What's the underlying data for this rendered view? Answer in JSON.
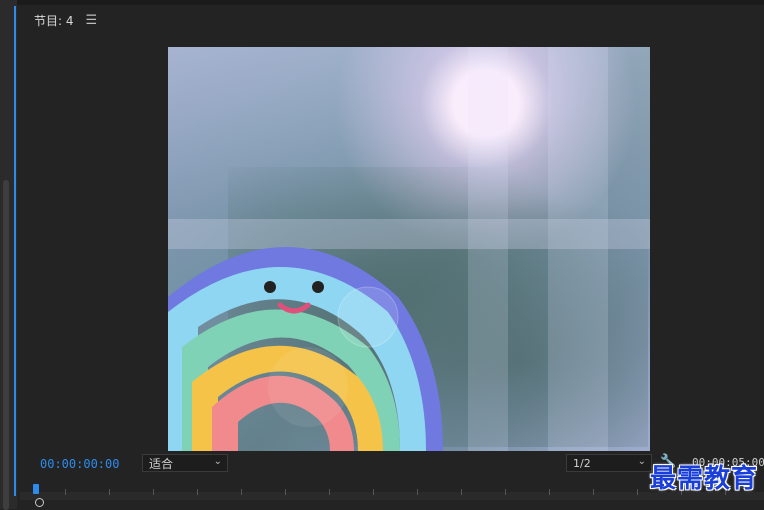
{
  "panel": {
    "title": "节目: 4",
    "menu_icon": "hamburger-menu-icon"
  },
  "playback": {
    "timecode": "00:00:00:00",
    "zoom_value": "适合",
    "resolution_value": "1/2",
    "duration": "00:00:05:00"
  },
  "watermark": {
    "text": "最需教育"
  },
  "colors": {
    "accent": "#2d8ceb",
    "background": "#232323",
    "watermark": "#1a3fd8"
  }
}
